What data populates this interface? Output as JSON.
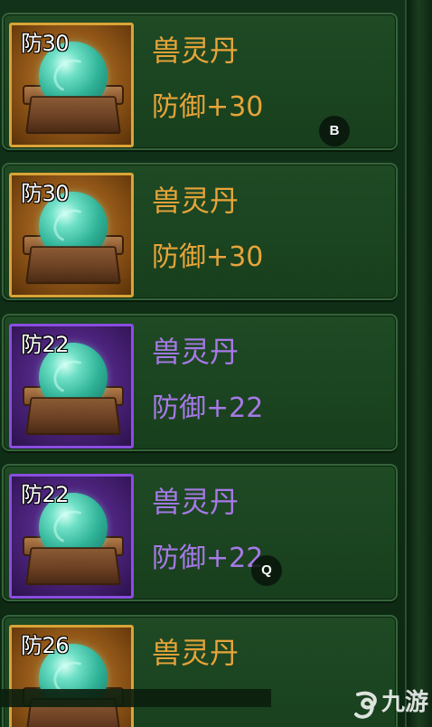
{
  "items": [
    {
      "tag": "防30",
      "name": "兽灵丹",
      "effect": "防御+30",
      "rarity": "gold"
    },
    {
      "tag": "防30",
      "name": "兽灵丹",
      "effect": "防御+30",
      "rarity": "gold"
    },
    {
      "tag": "防22",
      "name": "兽灵丹",
      "effect": "防御+22",
      "rarity": "purple"
    },
    {
      "tag": "防22",
      "name": "兽灵丹",
      "effect": "防御+22",
      "rarity": "purple"
    },
    {
      "tag": "防26",
      "name": "兽灵丹",
      "effect": "",
      "rarity": "gold"
    }
  ],
  "hints": {
    "b": "B",
    "q": "Q"
  },
  "watermark": {
    "text": "九游",
    "icon": "jiuyou-logo-icon"
  },
  "colors": {
    "gold": "#e7a43a",
    "purple": "#a779e8",
    "gold_border": "#d9a437",
    "purple_border": "#8a4ee0",
    "card_bg": "#1f4a24"
  }
}
